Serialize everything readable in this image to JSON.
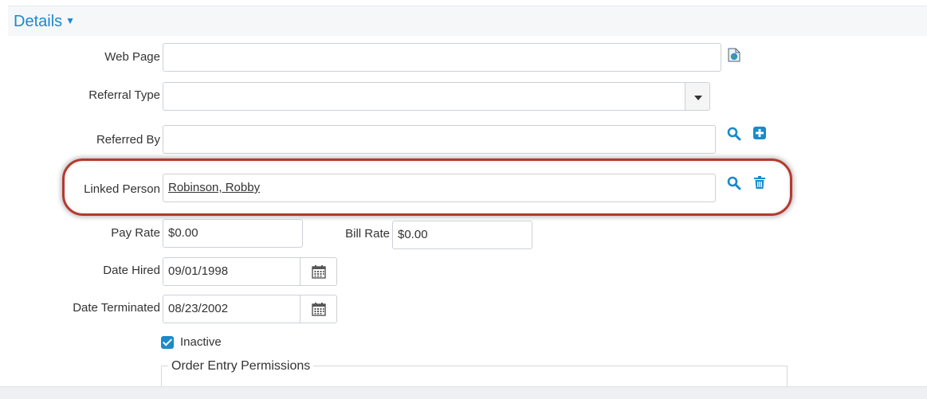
{
  "details": {
    "title": "Details"
  },
  "fields": {
    "web_page": {
      "label": "Web Page",
      "value": ""
    },
    "referral_type": {
      "label": "Referral Type",
      "value": ""
    },
    "referred_by": {
      "label": "Referred By",
      "value": ""
    },
    "linked_person": {
      "label": "Linked Person",
      "value": "Robinson, Robby"
    },
    "pay_rate": {
      "label": "Pay Rate",
      "value": "$0.00"
    },
    "bill_rate": {
      "label": "Bill Rate",
      "value": "$0.00"
    },
    "date_hired": {
      "label": "Date Hired",
      "value": "09/01/1998"
    },
    "date_terminated": {
      "label": "Date Terminated",
      "value": "08/23/2002"
    }
  },
  "inactive": {
    "label": "Inactive",
    "checked": true
  },
  "order_entry": {
    "legend": "Order Entry Permissions"
  },
  "icons": {
    "web_page_link": "globe-page-icon",
    "search": "search-icon",
    "add": "plus-square-icon",
    "delete": "trash-icon",
    "calendar": "calendar-icon",
    "dropdown": "caret-down-icon"
  },
  "colors": {
    "accent": "#1a8acb",
    "highlight": "#b5392e"
  }
}
